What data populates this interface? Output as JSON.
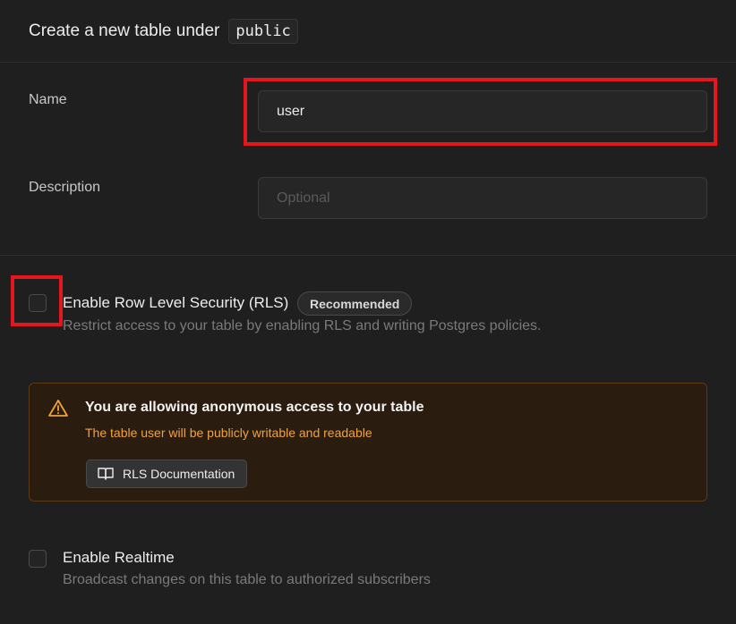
{
  "header": {
    "title": "Create a new table under",
    "schema": "public"
  },
  "form": {
    "name_label": "Name",
    "name_value": "user",
    "description_label": "Description",
    "description_placeholder": "Optional"
  },
  "rls": {
    "title": "Enable Row Level Security (RLS)",
    "badge": "Recommended",
    "description": "Restrict access to your table by enabling RLS and writing Postgres policies.",
    "checked": false
  },
  "alert": {
    "icon": "warning-triangle-icon",
    "title": "You are allowing anonymous access to your table",
    "subtitle": "The table user will be publicly writable and readable",
    "button_label": "RLS Documentation",
    "button_icon": "book-icon",
    "accent_color": "#f0a33c"
  },
  "realtime": {
    "title": "Enable Realtime",
    "description": "Broadcast changes on this table to authorized subscribers",
    "checked": false
  },
  "colors": {
    "highlight": "#e5161f",
    "background": "#1f1f1f"
  }
}
